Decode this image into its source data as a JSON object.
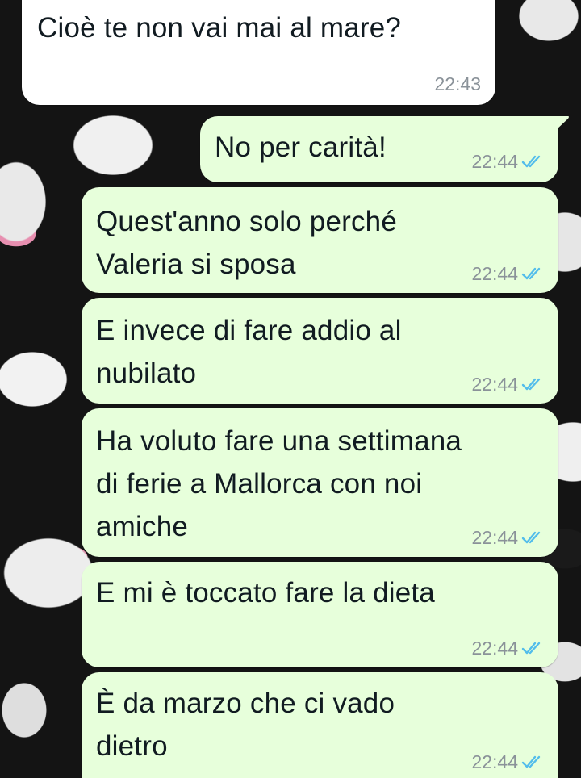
{
  "chat": {
    "read_tick_color": "#53bdeb",
    "incoming_bubble_color": "#ffffff",
    "outgoing_bubble_color": "#e7ffdb",
    "messages": [
      {
        "direction": "incoming",
        "text": "Cioè te non vai mai al mare?",
        "time": "22:43"
      },
      {
        "direction": "outgoing",
        "text": "No per carità!",
        "time": "22:44",
        "status_icon": "double-check-read-icon"
      },
      {
        "direction": "outgoing",
        "text": "Quest'anno solo perché\nValeria si sposa",
        "time": "22:44",
        "status_icon": "double-check-read-icon"
      },
      {
        "direction": "outgoing",
        "text": "E invece di fare addio al\nnubilato",
        "time": "22:44",
        "status_icon": "double-check-read-icon"
      },
      {
        "direction": "outgoing",
        "text": "Ha voluto fare una settimana\ndi ferie a Mallorca con noi\namiche",
        "time": "22:44",
        "status_icon": "double-check-read-icon"
      },
      {
        "direction": "outgoing",
        "text": "E mi è toccato fare la dieta",
        "time": "22:44",
        "status_icon": "double-check-read-icon"
      },
      {
        "direction": "outgoing",
        "text": "È da marzo che ci vado\ndietro",
        "time": "22:44",
        "status_icon": "double-check-read-icon"
      }
    ]
  }
}
